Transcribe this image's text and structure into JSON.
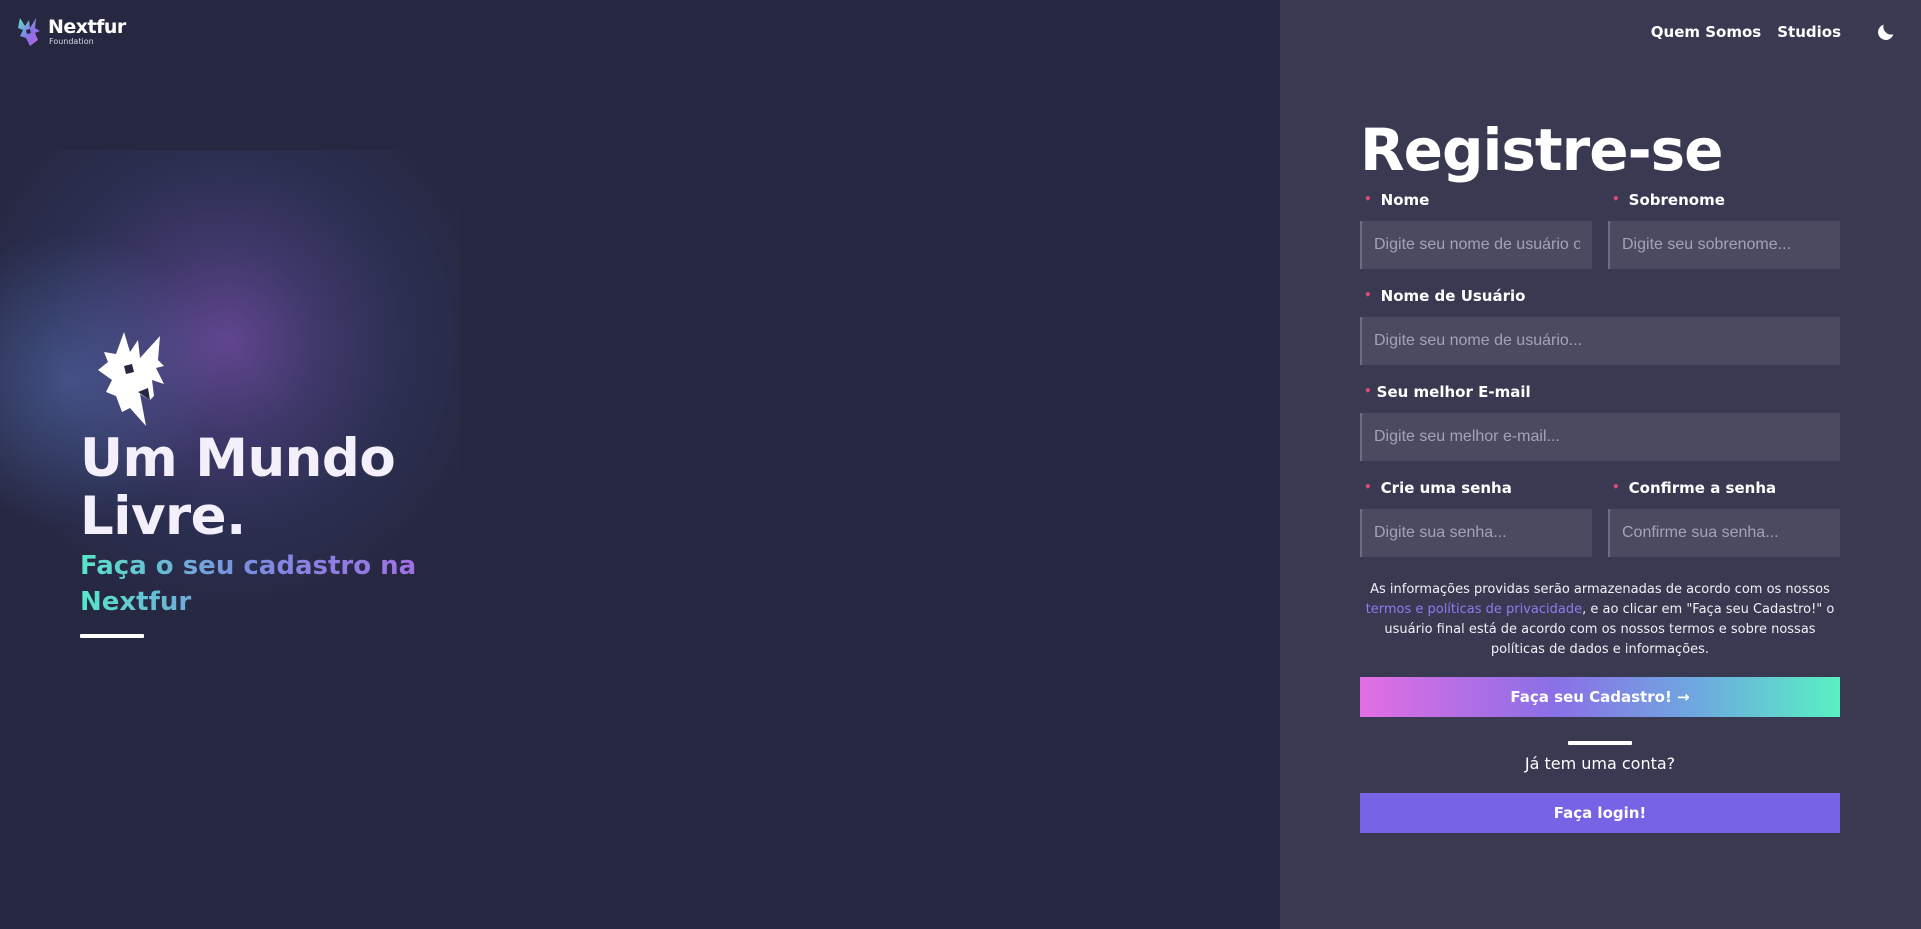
{
  "brand": {
    "name": "Nextfur",
    "subtitle": "Foundation"
  },
  "nav": {
    "items": [
      {
        "label": "Quem Somos"
      },
      {
        "label": "Studios"
      }
    ],
    "theme_toggle_icon": "moon-icon"
  },
  "hero": {
    "title": "Um Mundo Livre.",
    "subtitle": "Faça o seu cadastro na Nextfur"
  },
  "form": {
    "title": "Registre-se",
    "fields": {
      "first_name": {
        "label": "Nome",
        "placeholder": "Digite seu nome de usuário ou nome"
      },
      "last_name": {
        "label": "Sobrenome",
        "placeholder": "Digite seu sobrenome..."
      },
      "username": {
        "label": "Nome de Usuário",
        "placeholder": "Digite seu nome de usuário..."
      },
      "email": {
        "label": "Seu melhor E-mail",
        "placeholder": "Digite seu melhor e-mail..."
      },
      "password": {
        "label": "Crie uma senha",
        "placeholder": "Digite sua senha..."
      },
      "confirm_password": {
        "label": "Confirme a senha",
        "placeholder": "Confirme sua senha..."
      }
    },
    "terms": {
      "before": "As informações providas serão armazenadas de acordo com os nossos ",
      "link": "termos e políticas de privacidade",
      "after": ", e ao clicar em \"Faça seu Cadastro!\" o usuário final está de acordo com os nossos termos e sobre nossas políticas de dados e informações."
    },
    "submit_label": "Faça seu Cadastro! →",
    "have_account": "Já tem uma conta?",
    "login_label": "Faça login!"
  },
  "colors": {
    "left_bg": "#262740",
    "right_bg": "#393952",
    "accent": "#7763e5",
    "required": "#e0457a",
    "link": "#8f7bef"
  }
}
